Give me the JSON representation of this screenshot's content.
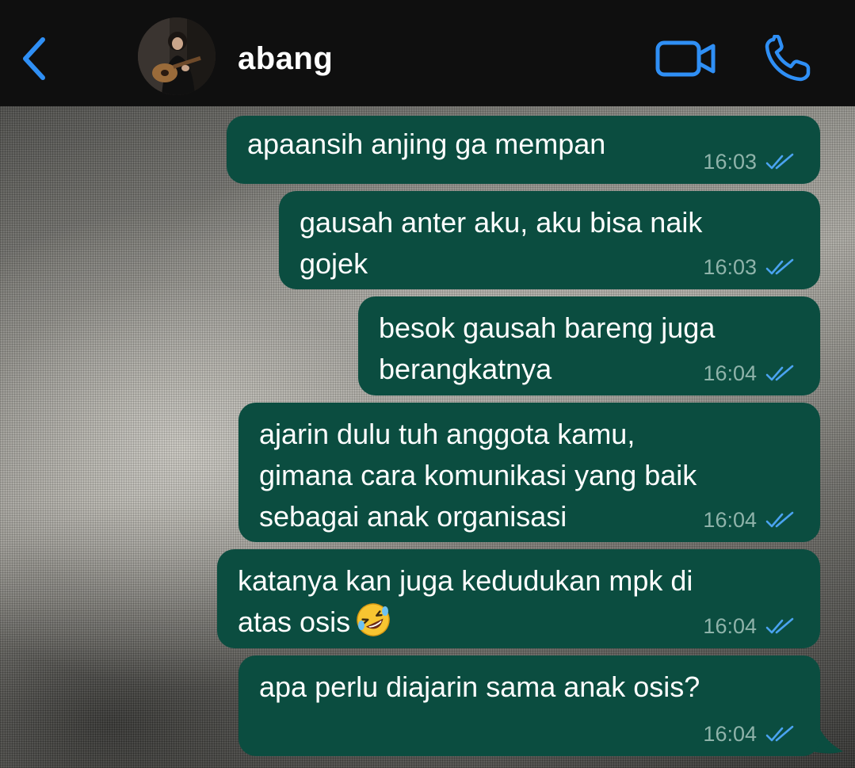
{
  "header": {
    "contact_name": "abang",
    "back_icon": "chevron-left-icon",
    "video_icon": "video-camera-icon",
    "call_icon": "phone-icon",
    "accent_color": "#2f8ff5",
    "background_color": "#0f0f0f"
  },
  "chat": {
    "bubble_color": "#0b4d40",
    "messages": [
      {
        "text": "apaansih anjing ga mempan",
        "time": "16:03",
        "status": "read"
      },
      {
        "text": "gausah anter aku, aku bisa naik\ngojek",
        "time": "16:03",
        "status": "read"
      },
      {
        "text": "besok gausah bareng juga\nberangkatnya",
        "time": "16:04",
        "status": "read"
      },
      {
        "text": "ajarin dulu tuh anggota kamu,\ngimana cara komunikasi yang baik\nsebagai anak organisasi",
        "time": "16:04",
        "status": "read"
      },
      {
        "text": "katanya kan juga kedudukan mpk di\natas osis",
        "emoji": "rolling-on-floor-laughing-emoji",
        "time": "16:04",
        "status": "read"
      },
      {
        "text": "apa perlu diajarin sama anak osis?",
        "time": "16:04",
        "status": "read"
      }
    ]
  }
}
